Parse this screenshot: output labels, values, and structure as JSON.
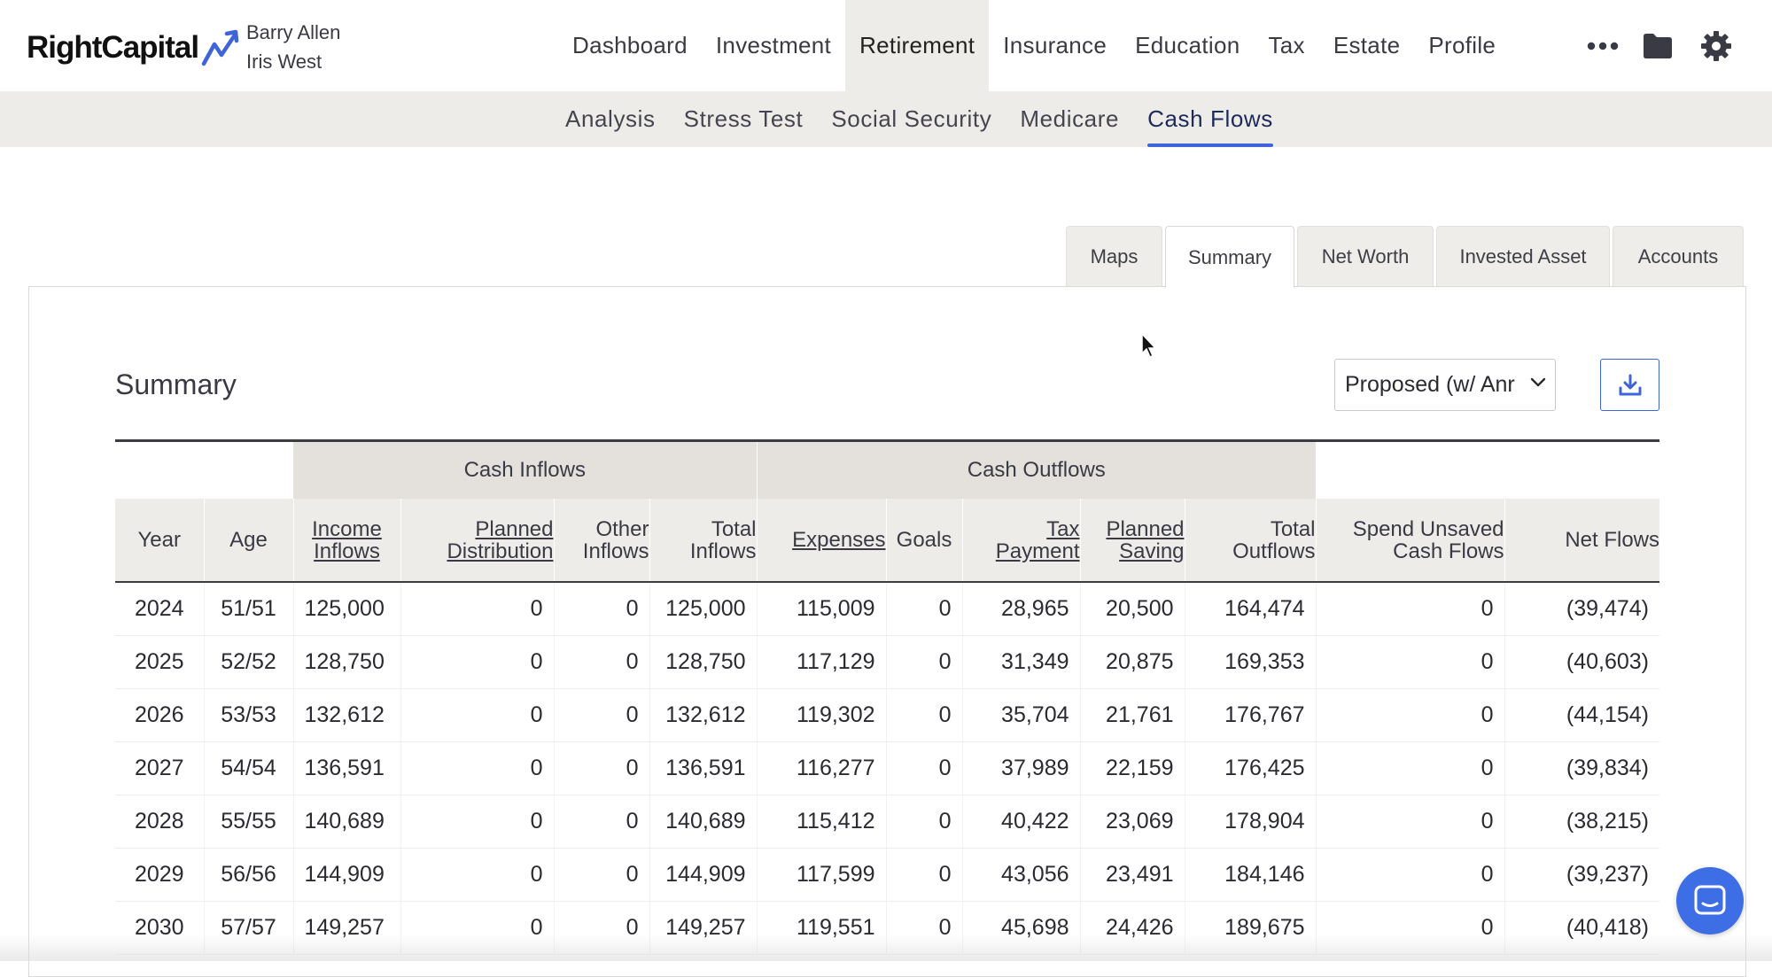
{
  "app": {
    "brand": "RightCapital",
    "clients": [
      "Barry Allen",
      "Iris West"
    ]
  },
  "main_nav": [
    {
      "label": "Dashboard",
      "active": false
    },
    {
      "label": "Investment",
      "active": false
    },
    {
      "label": "Retirement",
      "active": true
    },
    {
      "label": "Insurance",
      "active": false
    },
    {
      "label": "Education",
      "active": false
    },
    {
      "label": "Tax",
      "active": false
    },
    {
      "label": "Estate",
      "active": false
    },
    {
      "label": "Profile",
      "active": false
    }
  ],
  "top_icons": [
    "more-icon",
    "folder-icon",
    "gear-icon"
  ],
  "sub_nav": [
    {
      "label": "Analysis",
      "active": false
    },
    {
      "label": "Stress Test",
      "active": false
    },
    {
      "label": "Social Security",
      "active": false
    },
    {
      "label": "Medicare",
      "active": false
    },
    {
      "label": "Cash Flows",
      "active": true
    }
  ],
  "tabs": [
    {
      "label": "Maps",
      "active": false
    },
    {
      "label": "Summary",
      "active": true
    },
    {
      "label": "Net Worth",
      "active": false
    },
    {
      "label": "Invested Asset",
      "active": false
    },
    {
      "label": "Accounts",
      "active": false
    }
  ],
  "summary": {
    "title": "Summary",
    "scenario_select": "Proposed (w/ Anr",
    "download_icon": "download-icon"
  },
  "table": {
    "groups": {
      "inflows": "Cash Inflows",
      "outflows": "Cash Outflows"
    },
    "columns": [
      {
        "label": "Year",
        "link": false
      },
      {
        "label": "Age",
        "link": false
      },
      {
        "label": "Income Inflows",
        "link": true
      },
      {
        "label": "Planned Distribution",
        "link": true
      },
      {
        "label": "Other Inflows",
        "link": false
      },
      {
        "label": "Total Inflows",
        "link": false
      },
      {
        "label": "Expenses",
        "link": true
      },
      {
        "label": "Goals",
        "link": false
      },
      {
        "label": "Tax Payment",
        "link": true
      },
      {
        "label": "Planned Saving",
        "link": true
      },
      {
        "label": "Total Outflows",
        "link": false
      },
      {
        "label": "Spend Unsaved Cash Flows",
        "link": false
      },
      {
        "label": "Net Flows",
        "link": false
      }
    ],
    "rows": [
      [
        "2024",
        "51/51",
        "125,000",
        "0",
        "0",
        "125,000",
        "115,009",
        "0",
        "28,965",
        "20,500",
        "164,474",
        "0",
        "(39,474)"
      ],
      [
        "2025",
        "52/52",
        "128,750",
        "0",
        "0",
        "128,750",
        "117,129",
        "0",
        "31,349",
        "20,875",
        "169,353",
        "0",
        "(40,603)"
      ],
      [
        "2026",
        "53/53",
        "132,612",
        "0",
        "0",
        "132,612",
        "119,302",
        "0",
        "35,704",
        "21,761",
        "176,767",
        "0",
        "(44,154)"
      ],
      [
        "2027",
        "54/54",
        "136,591",
        "0",
        "0",
        "136,591",
        "116,277",
        "0",
        "37,989",
        "22,159",
        "176,425",
        "0",
        "(39,834)"
      ],
      [
        "2028",
        "55/55",
        "140,689",
        "0",
        "0",
        "140,689",
        "115,412",
        "0",
        "40,422",
        "23,069",
        "178,904",
        "0",
        "(38,215)"
      ],
      [
        "2029",
        "56/56",
        "144,909",
        "0",
        "0",
        "144,909",
        "117,599",
        "0",
        "43,056",
        "23,491",
        "184,146",
        "0",
        "(39,237)"
      ],
      [
        "2030",
        "57/57",
        "149,257",
        "0",
        "0",
        "149,257",
        "119,551",
        "0",
        "45,698",
        "24,426",
        "189,675",
        "0",
        "(40,418)"
      ]
    ]
  },
  "colors": {
    "accent": "#3f64d9",
    "nav_bg": "#eeece8",
    "group_bg": "#e4e1dc",
    "chat": "#3e6ee6"
  }
}
